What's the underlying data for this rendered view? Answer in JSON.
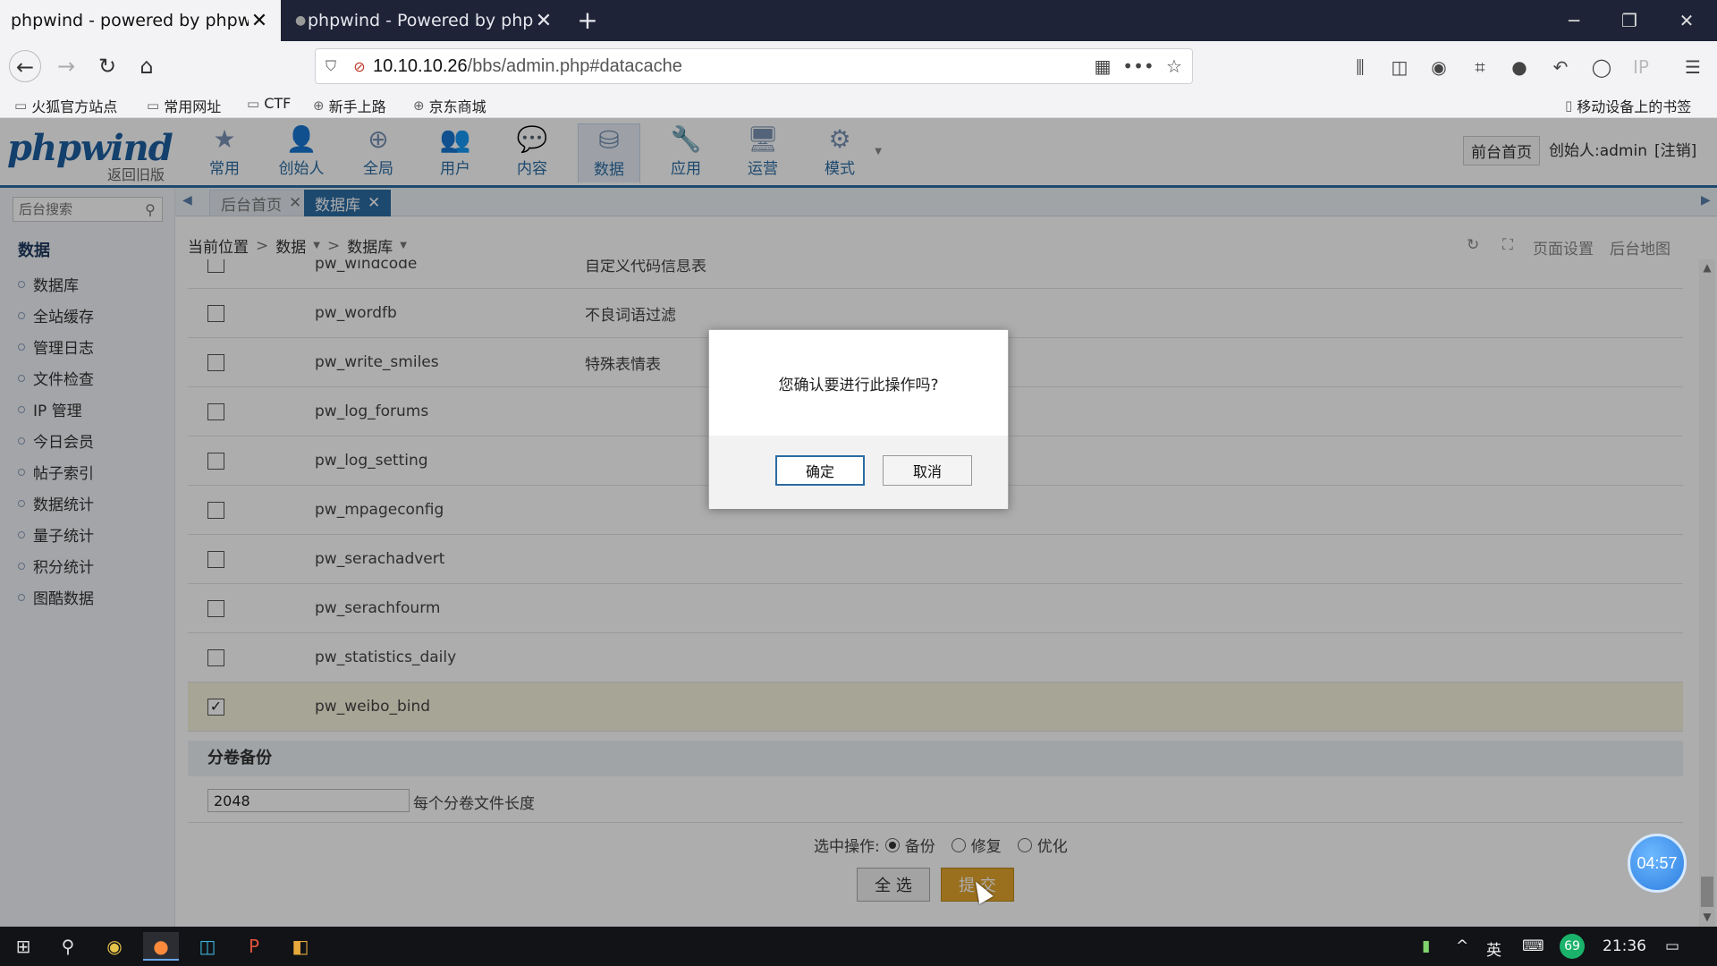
{
  "browser": {
    "tabs": [
      {
        "title": "phpwind - powered by phpwind",
        "close": "✕"
      },
      {
        "title": "phpwind - Powered by phpwind",
        "close": "✕"
      }
    ],
    "new_tab": "+",
    "window_controls": {
      "minimize": "─",
      "restore": "❐",
      "close": "✕"
    },
    "url_host": "10.10.10.26",
    "url_path": "/bbs/admin.php#datacache",
    "bookmarks": [
      "火狐官方站点",
      "常用网址",
      "CTF",
      "新手上路",
      "京东商城"
    ],
    "mobile_bookmarks": "移动设备上的书签"
  },
  "app": {
    "logo": "phpwind",
    "logo_sub": "返回旧版",
    "modules": [
      "常用",
      "创始人",
      "全局",
      "用户",
      "内容",
      "数据",
      "应用",
      "运营",
      "模式"
    ],
    "active_module": "数据",
    "header_front": "前台首页",
    "header_user": "创始人:admin",
    "header_logout": "[注销]"
  },
  "sidebar": {
    "search_placeholder": "后台搜索",
    "title": "数据",
    "items": [
      "数据库",
      "全站缓存",
      "管理日志",
      "文件检查",
      "IP 管理",
      "今日会员",
      "帖子索引",
      "数据统计",
      "量子统计",
      "积分统计",
      "图酷数据"
    ]
  },
  "admin_tabs": [
    {
      "label": "后台首页",
      "close": "✕"
    },
    {
      "label": "数据库",
      "close": "✕"
    }
  ],
  "breadcrumb": {
    "root": "当前位置",
    "level1": "数据",
    "level2": "数据库",
    "sep": ">"
  },
  "crumb_tools": {
    "page_settings": "页面设置",
    "site_map": "后台地图"
  },
  "tables": [
    {
      "name": "pw_windcode",
      "desc": "自定义代码信息表",
      "checked": false
    },
    {
      "name": "pw_wordfb",
      "desc": "不良词语过滤",
      "checked": false
    },
    {
      "name": "pw_write_smiles",
      "desc": "特殊表情表",
      "checked": false
    },
    {
      "name": "pw_log_forums",
      "desc": "",
      "checked": false
    },
    {
      "name": "pw_log_setting",
      "desc": "",
      "checked": false
    },
    {
      "name": "pw_mpageconfig",
      "desc": "",
      "checked": false
    },
    {
      "name": "pw_serachadvert",
      "desc": "",
      "checked": false
    },
    {
      "name": "pw_serachfourm",
      "desc": "",
      "checked": false
    },
    {
      "name": "pw_statistics_daily",
      "desc": "",
      "checked": false
    },
    {
      "name": "pw_weibo_bind",
      "desc": "",
      "checked": true
    }
  ],
  "volume": {
    "title": "分卷备份",
    "value": "2048",
    "label": "每个分卷文件长度"
  },
  "ops": {
    "label": "选中操作:",
    "options": [
      "备份",
      "修复",
      "优化"
    ],
    "selected": "备份"
  },
  "buttons": {
    "select_all": "全 选",
    "submit": "提 交"
  },
  "dialog": {
    "message": "您确认要进行此操作吗?",
    "ok": "确定",
    "cancel": "取消"
  },
  "timer": "04:57",
  "taskbar": {
    "ime": "英",
    "badge": "69",
    "time": "21:36"
  }
}
